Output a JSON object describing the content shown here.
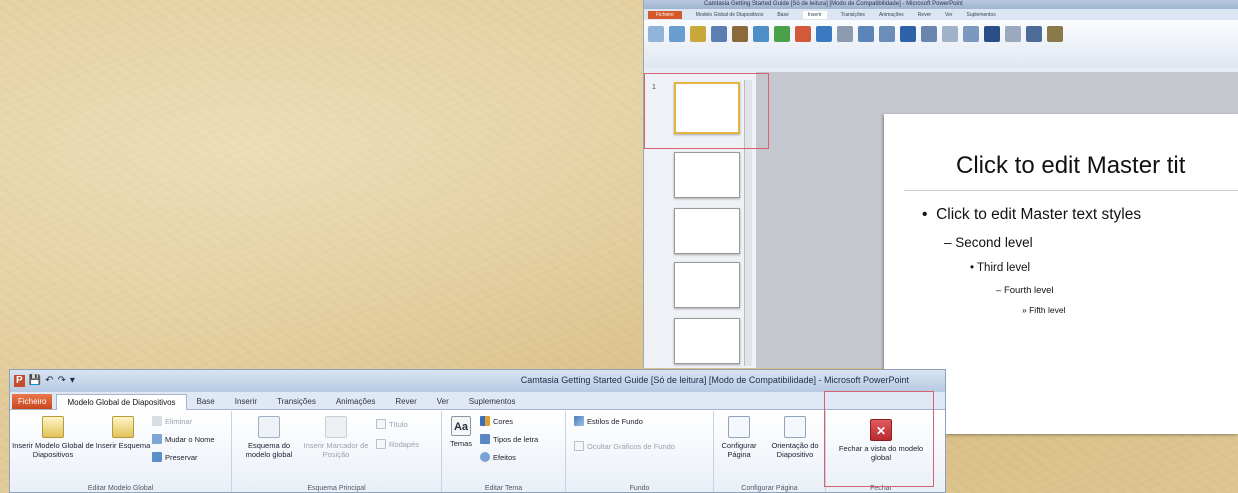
{
  "top_window": {
    "title": "Camtasia Getting Started Guide [Só de leitura] [Modo de Compatibilidade] - Microsoft PowerPoint",
    "tabs": [
      "Ficheiro",
      "Modelo Global de Diapositivos",
      "Base",
      "Inserir",
      "Transições",
      "Animações",
      "Rever",
      "Ver",
      "Suplementos"
    ],
    "active_tab": "Inserir",
    "slide_numbers": [
      "1"
    ]
  },
  "slide": {
    "title": "Click to edit Master tit",
    "levels": [
      {
        "bullet": "•",
        "text": "Click to edit Master text styles"
      },
      {
        "bullet": "–",
        "text": "Second level"
      },
      {
        "bullet": "•",
        "text": "Third level"
      },
      {
        "bullet": "–",
        "text": "Fourth level"
      },
      {
        "bullet": "»",
        "text": "Fifth level"
      }
    ]
  },
  "bottom_window": {
    "title": "Camtasia Getting Started Guide [Só de leitura] [Modo de Compatibilidade] - Microsoft PowerPoint",
    "qat": [
      "P",
      "💾",
      "↶",
      "↷",
      "▾"
    ],
    "tabs": {
      "file": "Ficheiro",
      "active": "Modelo Global de Diapositivos",
      "others": [
        "Base",
        "Inserir",
        "Transições",
        "Animações",
        "Rever",
        "Ver",
        "Suplementos"
      ]
    },
    "groups": {
      "editar_modelo": {
        "label": "Editar Modelo Global",
        "insert_master": "Inserir Modelo Global de Diapositivos",
        "insert_layout": "Inserir Esquema",
        "delete": "Eliminar",
        "rename": "Mudar o Nome",
        "preserve": "Preservar"
      },
      "esquema_principal": {
        "label": "Esquema Principal",
        "master_layout": "Esquema do modelo global",
        "insert_placeholder": "Inserir Marcador de Posição",
        "title": "Título",
        "footers": "Rodapés"
      },
      "editar_tema": {
        "label": "Editar Tema",
        "themes": "Temas",
        "colors": "Cores",
        "fonts": "Tipos de letra",
        "effects": "Efeitos"
      },
      "fundo": {
        "label": "Fundo",
        "background_styles": "Estilos de Fundo",
        "hide_graphics": "Ocultar Gráficos de Fundo"
      },
      "configurar_pagina": {
        "label": "Configurar Página",
        "page_setup": "Configurar Página",
        "orientation": "Orientação do Diapositivo"
      },
      "fechar": {
        "label": "Fechar",
        "close_master": "Fechar a vista do modelo global"
      }
    }
  },
  "colors": {
    "highlight_box": "#d3646f",
    "file_tab": "#d4582a",
    "ribbon_border": "#a3b5cd",
    "close_icon": "#c9343a"
  }
}
